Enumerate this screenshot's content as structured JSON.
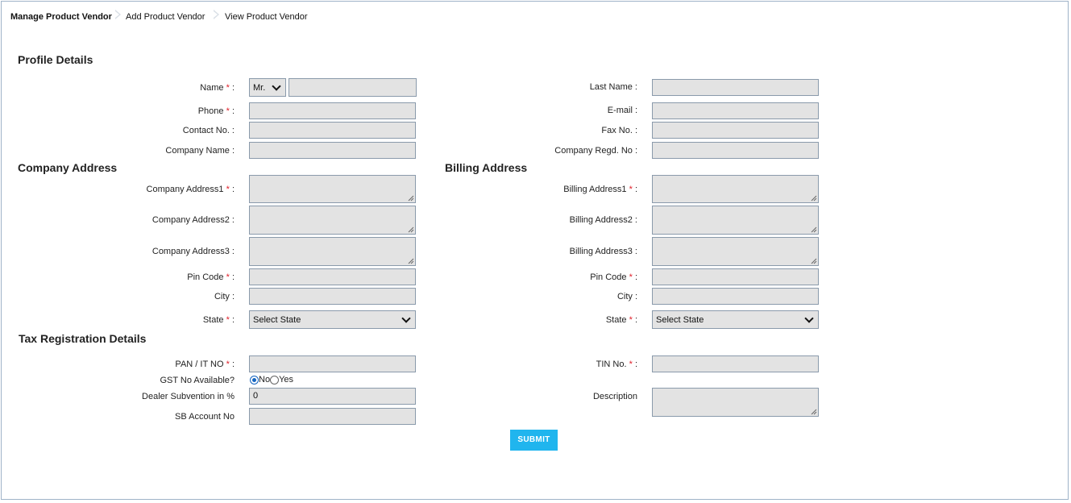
{
  "breadcrumb": {
    "manage": "Manage Product Vendor",
    "add": "Add Product Vendor",
    "view": "View Product Vendor"
  },
  "sections": {
    "profile": "Profile Details",
    "company_address": "Company Address",
    "billing_address": "Billing Address",
    "tax": "Tax Registration Details"
  },
  "labels": {
    "name": "Name",
    "last_name": "Last Name :",
    "phone": "Phone",
    "email": "E-mail :",
    "contact": "Contact No. :",
    "fax": "Fax No. :",
    "company_name": "Company Name :",
    "company_regd": "Company Regd. No :",
    "company_address1": "Company Address1",
    "company_address2": "Company Address2 :",
    "company_address3": "Company Address3 :",
    "pin_code": "Pin Code",
    "city": "City :",
    "state": "State",
    "billing_address1": "Billing Address1",
    "billing_address2": "Billing Address2 :",
    "billing_address3": "Billing Address3 :",
    "pan": "PAN / IT NO",
    "tin": "TIN No.",
    "gst": "GST No Available?",
    "dealer_subvention": "Dealer Subvention in %",
    "sb_account": "SB Account No",
    "description": "Description",
    "required_marker": "*",
    "colon": ":"
  },
  "fields": {
    "title_select": "Mr.",
    "state_select": "Select State",
    "billing_state_select": "Select State",
    "dealer_subvention_value": "0"
  },
  "gst_options": {
    "no": "No",
    "yes": "Yes",
    "selected": "No"
  },
  "submit_label": "SUBMIT",
  "colors": {
    "accent": "#20b5ee",
    "required": "#e0202a",
    "input_bg": "#e3e3e3"
  }
}
